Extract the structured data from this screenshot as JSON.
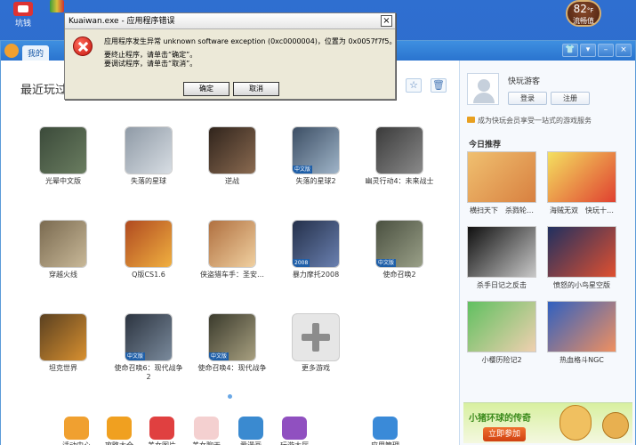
{
  "desktop": {
    "icon_label": "坑钱",
    "temp": {
      "value": "82",
      "unit": "°F",
      "label": "流畅值"
    }
  },
  "app": {
    "tab": "我的",
    "section_title": "最近玩过",
    "games": [
      {
        "name": "光晕中文版",
        "color1": "#3b4a3a",
        "color2": "#6a7d60"
      },
      {
        "name": "失落的星球",
        "color1": "#8f9aa6",
        "color2": "#d7dde3"
      },
      {
        "name": "逆战",
        "color1": "#30241c",
        "color2": "#8a6a50"
      },
      {
        "name": "失落的星球2",
        "color1": "#3c4e64",
        "color2": "#9fb4c8",
        "badge": "中文版"
      },
      {
        "name": "幽灵行动4：未来战士",
        "color1": "#3a3a3a",
        "color2": "#8a8a8a"
      },
      {
        "name": "穿越火线",
        "color1": "#7a6a50",
        "color2": "#c8b898"
      },
      {
        "name": "Q版CS1.6",
        "color1": "#b04a20",
        "color2": "#f0b040"
      },
      {
        "name": "侠盗猎车手：圣安…",
        "color1": "#b07040",
        "color2": "#f0d0a0"
      },
      {
        "name": "暴力摩托2008",
        "color1": "#24304a",
        "color2": "#6a80b0",
        "badge": "2008"
      },
      {
        "name": "使命召唤2",
        "color1": "#4a5040",
        "color2": "#9aa088",
        "badge": "中文版"
      },
      {
        "name": "坦克世界",
        "color1": "#5a4020",
        "color2": "#d89030"
      },
      {
        "name": "使命召唤6：现代战争2",
        "color1": "#2c3440",
        "color2": "#7a8a9c",
        "badge": "中文版"
      },
      {
        "name": "使命召唤4：现代战争",
        "color1": "#3a3a2c",
        "color2": "#a8a080",
        "badge": "中文版"
      },
      {
        "name": "更多游戏",
        "plus": true
      }
    ],
    "bottom": [
      {
        "label": "活动中心",
        "color": "#f0a030"
      },
      {
        "label": "攻略大全",
        "color": "#f0a020"
      },
      {
        "label": "美女图片",
        "color": "#e04040"
      },
      {
        "label": "美女聊天",
        "color": "#f4d0d0"
      },
      {
        "label": "爱漫画",
        "color": "#3a8ad0"
      },
      {
        "label": "玩游大厅",
        "color": "#9050c0"
      },
      {
        "label": "应用管理",
        "color": "#3a8ad8"
      }
    ],
    "right": {
      "guest_name": "快玩游客",
      "login": "登录",
      "register": "注册",
      "member_note": "成为快玩会员享受一站式的游戏服务",
      "today_title": "今日推荐",
      "recs": [
        {
          "name": "横扫天下　杀戮轮…",
          "c1": "#f0c070",
          "c2": "#d88040"
        },
        {
          "name": "海贼无双　快玩十…",
          "c1": "#f4e060",
          "c2": "#e04030"
        },
        {
          "name": "杀手日记之反击",
          "c1": "#101010",
          "c2": "#c8c8c8"
        },
        {
          "name": "愤怒的小鸟星空版",
          "c1": "#203060",
          "c2": "#e05030"
        },
        {
          "name": "小樱历险记2",
          "c1": "#60c060",
          "c2": "#f0d0b0"
        },
        {
          "name": "热血格斗NGC",
          "c1": "#3060c0",
          "c2": "#f09060"
        }
      ],
      "ad_title": "小猪环球的传奇",
      "ad_button": "立即参加"
    }
  },
  "dialog": {
    "title": "Kuaiwan.exe - 应用程序错误",
    "line1": "应用程序发生异常 unknown software exception (0xc0000004)，位置为 0x0057f7f5。",
    "line2": "要终止程序，请单击“确定”。",
    "line3": "要调试程序，请单击“取消”。",
    "ok": "确定",
    "cancel": "取消",
    "close": "×"
  }
}
